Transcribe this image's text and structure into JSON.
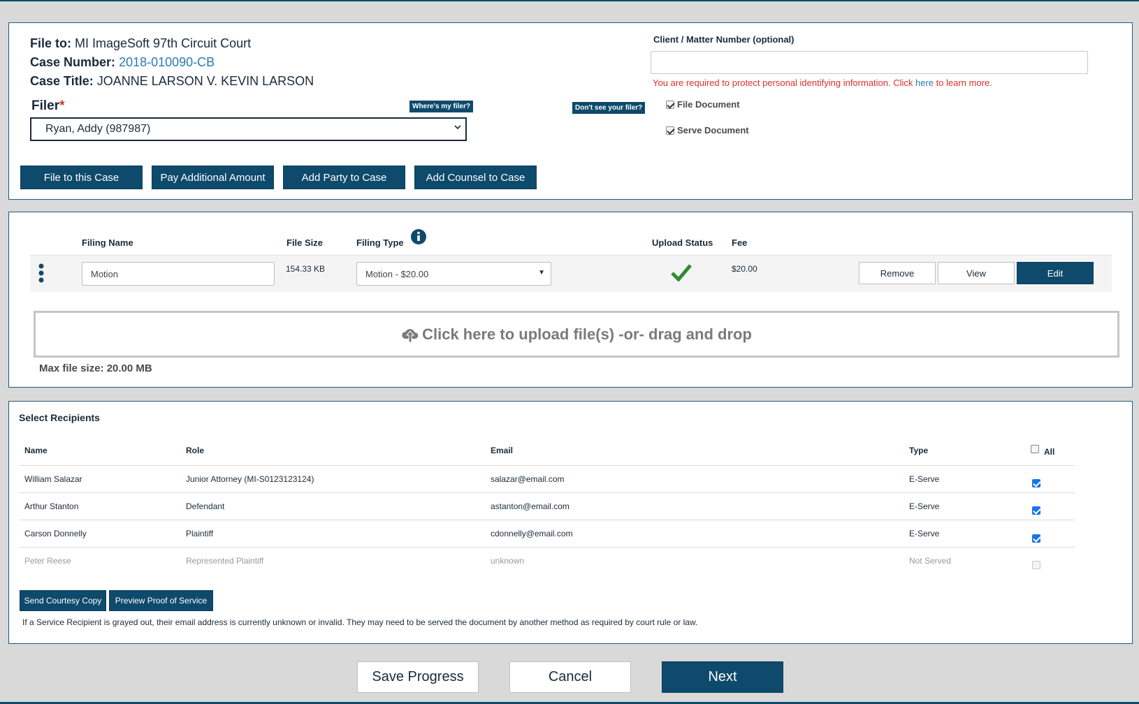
{
  "case": {
    "file_to_label": "File to:",
    "file_to_value": "MI ImageSoft 97th Circuit Court",
    "case_number_label": "Case Number:",
    "case_number_value": "2018-010090-CB",
    "case_title_label": "Case Title:",
    "case_title_value": "JOANNE LARSON V. KEVIN LARSON"
  },
  "filer": {
    "label": "Filer",
    "required_mark": "*",
    "wheres_my_filer": "Where's my filer?",
    "dont_see_filer": "Don't see your filer?",
    "selected": "Ryan, Addy (987987)"
  },
  "case_actions": [
    "File to this Case",
    "Pay Additional Amount",
    "Add Party to Case",
    "Add Counsel to Case"
  ],
  "client_matter": {
    "label": "Client / Matter Number (optional)",
    "value": "",
    "warning_prefix": "You are required to protect personal identifying information. Click ",
    "warning_link": "here",
    "warning_suffix": " to learn more."
  },
  "options": {
    "file_document": {
      "label": "File Document",
      "checked": true
    },
    "serve_document": {
      "label": "Serve Document",
      "checked": true
    }
  },
  "filings": {
    "headers": {
      "name": "Filing Name",
      "size": "File Size",
      "type": "Filing Type",
      "status": "Upload Status",
      "fee": "Fee"
    },
    "rows": [
      {
        "name": "Motion",
        "size": "154.33 KB",
        "type": "Motion - $20.00",
        "status": "uploaded",
        "fee": "$20.00",
        "remove_label": "Remove",
        "view_label": "View",
        "edit_label": "Edit"
      }
    ]
  },
  "upload": {
    "text": "Click here to upload file(s) -or- drag and drop",
    "max_size": "Max file size: 20.00 MB"
  },
  "recipients": {
    "title": "Select Recipients",
    "headers": {
      "name": "Name",
      "role": "Role",
      "email": "Email",
      "type": "Type",
      "all": "All"
    },
    "rows": [
      {
        "name": "William Salazar",
        "role": "Junior Attorney (MI-S0123123124)",
        "email": "salazar@email.com",
        "type": "E-Serve",
        "checked": true,
        "disabled": false
      },
      {
        "name": "Arthur Stanton",
        "role": "Defendant",
        "email": "astanton@email.com",
        "type": "E-Serve",
        "checked": true,
        "disabled": false
      },
      {
        "name": "Carson Donnelly",
        "role": "Plaintiff",
        "email": "cdonnelly@email.com",
        "type": "E-Serve",
        "checked": true,
        "disabled": false
      },
      {
        "name": "Peter Reese",
        "role": "Represented Plaintiff",
        "email": "unknown",
        "type": "Not Served",
        "checked": false,
        "disabled": true
      }
    ],
    "send_courtesy_copy": "Send Courtesy Copy",
    "preview_proof": "Preview Proof of Service",
    "note": "If a Service Recipient is grayed out, their email address is currently unknown or invalid. They may need to be served the document by another method as required by court rule or law."
  },
  "footer": {
    "save_progress": "Save Progress",
    "cancel": "Cancel",
    "next": "Next"
  },
  "colors": {
    "primary": "#0e4a6b",
    "error": "#d9302b",
    "link": "#2a7ab5",
    "success": "#2e8b2e"
  }
}
